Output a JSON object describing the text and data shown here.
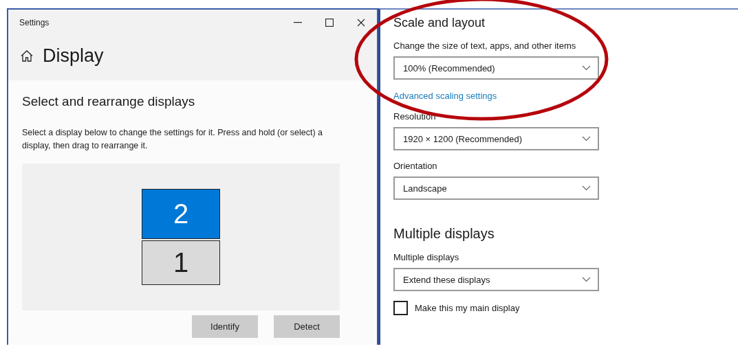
{
  "window": {
    "title": "Settings"
  },
  "page": {
    "title": "Display"
  },
  "arrange": {
    "heading": "Select and rearrange displays",
    "description": "Select a display below to change the settings for it. Press and hold (or select) a display, then drag to rearrange it.",
    "displays": [
      {
        "label": "2",
        "selected": true
      },
      {
        "label": "1",
        "selected": false
      }
    ],
    "buttons": [
      "Identify",
      "Detect"
    ]
  },
  "settings": [
    {
      "kind": "heading",
      "text": "Scale and layout"
    },
    {
      "kind": "dropdown",
      "label": "Change the size of text, apps, and other items",
      "value": "100% (Recommended)"
    },
    {
      "kind": "link",
      "text": "Advanced scaling settings"
    },
    {
      "kind": "dropdown",
      "label": "Resolution",
      "value": "1920 × 1200 (Recommended)"
    },
    {
      "kind": "dropdown",
      "label": "Orientation",
      "value": "Landscape"
    },
    {
      "kind": "heading",
      "text": "Multiple displays"
    },
    {
      "kind": "dropdown",
      "label": "Multiple displays",
      "value": "Extend these displays"
    },
    {
      "kind": "checkbox",
      "label": "Make this my main display",
      "checked": false
    }
  ],
  "annotation": {
    "kind": "ellipse"
  }
}
